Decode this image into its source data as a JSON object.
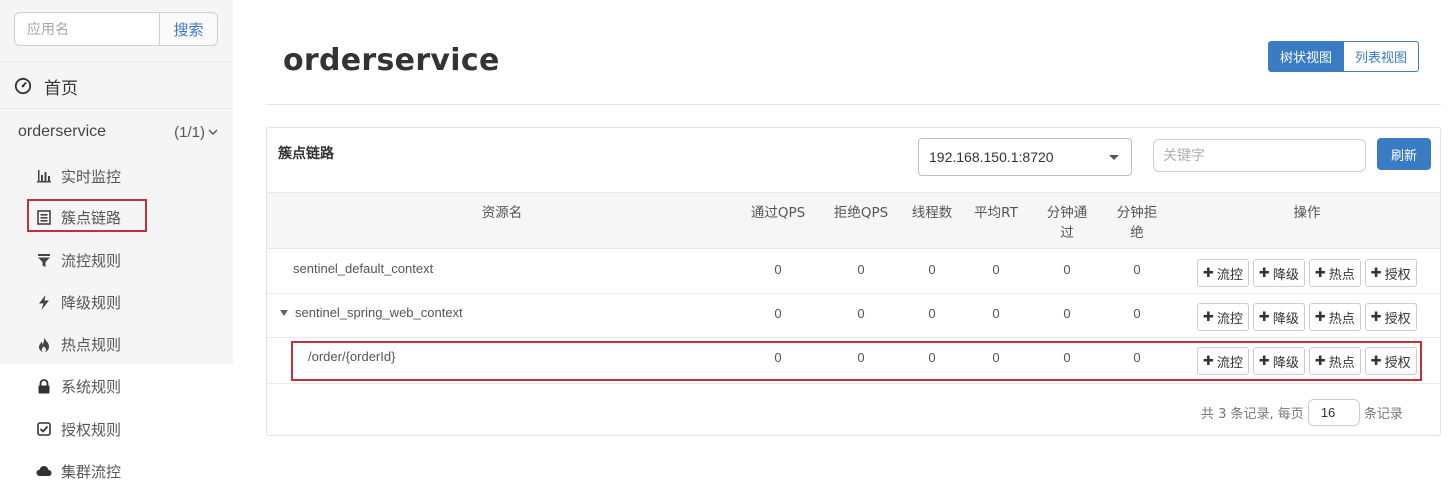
{
  "sidebar": {
    "search": {
      "placeholder": "应用名",
      "button_label": "搜索"
    },
    "home_label": "首页",
    "app": {
      "name": "orderservice",
      "count": "(1/1)"
    },
    "items": [
      {
        "label": "实时监控",
        "icon": "bar-chart-icon"
      },
      {
        "label": "簇点链路",
        "icon": "list-icon",
        "highlighted": true
      },
      {
        "label": "流控规则",
        "icon": "filter-icon"
      },
      {
        "label": "降级规则",
        "icon": "lightning-icon"
      },
      {
        "label": "热点规则",
        "icon": "fire-icon"
      },
      {
        "label": "系统规则",
        "icon": "lock-icon"
      },
      {
        "label": "授权规则",
        "icon": "check-square-icon"
      },
      {
        "label": "集群流控",
        "icon": "cloud-icon"
      }
    ]
  },
  "header": {
    "title": "orderservice",
    "views": {
      "tree": "树状视图",
      "list": "列表视图",
      "active": "tree"
    }
  },
  "panel": {
    "title": "簇点链路",
    "machine": "192.168.150.1:8720",
    "keyword_placeholder": "关键字",
    "refresh_label": "刷新",
    "columns": {
      "resource": "资源名",
      "pass_qps": "通过QPS",
      "block_qps": "拒绝QPS",
      "threads": "线程数",
      "avg_rt": "平均RT",
      "minute_pass": "分钟通过",
      "minute_block": "分钟拒绝",
      "ops": "操作"
    },
    "rows": [
      {
        "resource": "sentinel_default_context",
        "pass_qps": "0",
        "block_qps": "0",
        "threads": "0",
        "avg_rt": "0",
        "minute_pass": "0",
        "minute_block": "0"
      },
      {
        "resource": "sentinel_spring_web_context",
        "expanded": true,
        "pass_qps": "0",
        "block_qps": "0",
        "threads": "0",
        "avg_rt": "0",
        "minute_pass": "0",
        "minute_block": "0"
      },
      {
        "resource": "/order/{orderId}",
        "highlighted": true,
        "pass_qps": "0",
        "block_qps": "0",
        "threads": "0",
        "avg_rt": "0",
        "minute_pass": "0",
        "minute_block": "0"
      }
    ],
    "op_labels": {
      "flow": "流控",
      "degrade": "降级",
      "hotspot": "热点",
      "auth": "授权"
    },
    "pager": {
      "prefix": "共 3 条记录, 每页",
      "page_size": "16",
      "suffix": "条记录"
    }
  },
  "colors": {
    "primary": "#3a7cc3",
    "highlight_border": "#c3303c",
    "sidebar_bg": "#f5f5f5"
  }
}
